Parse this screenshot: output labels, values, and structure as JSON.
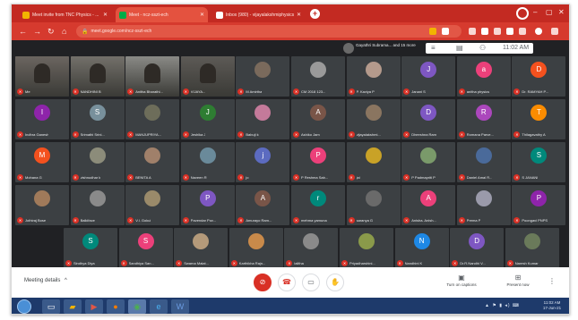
{
  "browser": {
    "tabs": [
      {
        "title": "Meet invite from TNC Physics - ...",
        "favicon_color": "#f2b400",
        "active": false
      },
      {
        "title": "Meet - ncz-sszt-ech",
        "favicon_color": "#00ac47",
        "active": true
      },
      {
        "title": "Inbox (980) - vijayalakshmiphysics...",
        "favicon_color": "#ffffff",
        "active": false
      }
    ],
    "new_tab": "+",
    "url": "meet.google.com/ncz-sszt-ech",
    "window_controls": [
      "–",
      "▢",
      "✕"
    ]
  },
  "meet_header": {
    "presenter_text": "Gayathri Subrama... and 15 more",
    "clock": "11:02 AM"
  },
  "participants": [
    {
      "name": "Me",
      "kind": "video",
      "color": "#6b6560"
    },
    {
      "name": "NANDHINI B",
      "kind": "video",
      "color": "#73706a"
    },
    {
      "name": "Anitha Bharathi...",
      "kind": "video",
      "color": "#8a8a86"
    },
    {
      "name": "VIJAYA...",
      "kind": "video",
      "color": "#5d5a56"
    },
    {
      "name": "M Amirtha",
      "kind": "photo",
      "color": "#7a6a5c",
      "initial": ""
    },
    {
      "name": "CM 2018 123...",
      "kind": "photo",
      "color": "#9a9a9a",
      "initial": ""
    },
    {
      "name": "P. Kaviya P",
      "kind": "photo",
      "color": "#b49a8c",
      "initial": ""
    },
    {
      "name": "Janani S",
      "kind": "letter",
      "color": "#7e57c2",
      "initial": "J"
    },
    {
      "name": "anitha physics",
      "kind": "letter",
      "color": "#ec407a",
      "initial": "a"
    },
    {
      "name": "Dr. RAMYAH P...",
      "kind": "letter",
      "color": "#f4511e",
      "initial": "D"
    },
    {
      "name": "Indhra Ganesh",
      "kind": "letter",
      "color": "#8e24aa",
      "initial": "I"
    },
    {
      "name": "Srimathi Srini...",
      "kind": "letter",
      "color": "#78909c",
      "initial": "S"
    },
    {
      "name": "MANJUPRIYA...",
      "kind": "photo",
      "color": "#6d6d5a",
      "initial": ""
    },
    {
      "name": "Jeshika J",
      "kind": "letter",
      "color": "#2e7d32",
      "initial": "J"
    },
    {
      "name": "Babuji k",
      "kind": "photo",
      "color": "#c47a9a",
      "initial": ""
    },
    {
      "name": "Ashiko Jam",
      "kind": "letter",
      "color": "#795548",
      "initial": "A"
    },
    {
      "name": "vijayalakshmi...",
      "kind": "photo",
      "color": "#8a7560",
      "initial": ""
    },
    {
      "name": "Dheeshna Ram",
      "kind": "letter",
      "color": "#7e57c2",
      "initial": "D"
    },
    {
      "name": "Romana Parve...",
      "kind": "letter",
      "color": "#ab47bc",
      "initial": "R"
    },
    {
      "name": "Thilagavathy A",
      "kind": "letter",
      "color": "#fb8c00",
      "initial": "T"
    },
    {
      "name": "Mohana G",
      "kind": "letter",
      "color": "#f4511e",
      "initial": "M"
    },
    {
      "name": "vishnudhar k",
      "kind": "photo",
      "color": "#8c8c7a",
      "initial": ""
    },
    {
      "name": "BENITA A",
      "kind": "photo",
      "color": "#a0806a",
      "initial": ""
    },
    {
      "name": "Naveen R",
      "kind": "photo",
      "color": "#6a8a9a",
      "initial": ""
    },
    {
      "name": "jo",
      "kind": "letter",
      "color": "#5c6bc0",
      "initial": "j"
    },
    {
      "name": "P Reshma Sab...",
      "kind": "letter",
      "color": "#ec407a",
      "initial": "P"
    },
    {
      "name": "jai",
      "kind": "photo",
      "color": "#c9a227",
      "initial": ""
    },
    {
      "name": "P Padmapriti P",
      "kind": "photo",
      "color": "#7a9a6a",
      "initial": ""
    },
    {
      "name": "Daniel Amal R...",
      "kind": "photo",
      "color": "#4a6a9a",
      "initial": ""
    },
    {
      "name": "S JANANI",
      "kind": "letter",
      "color": "#00897b",
      "initial": "S"
    },
    {
      "name": "Jothiraj Bose",
      "kind": "photo",
      "color": "#a07a5a",
      "initial": ""
    },
    {
      "name": "Balkiface",
      "kind": "photo",
      "color": "#8a8a8a",
      "initial": ""
    },
    {
      "name": "V.I. Gokul",
      "kind": "photo",
      "color": "#9a8a6a",
      "initial": ""
    },
    {
      "name": "Pavendar Pov...",
      "kind": "letter",
      "color": "#7e57c2",
      "initial": "P"
    },
    {
      "name": "Amurayo Ram...",
      "kind": "letter",
      "color": "#795548",
      "initial": "A"
    },
    {
      "name": "mehma yamuna",
      "kind": "letter",
      "color": "#00897b",
      "initial": "r"
    },
    {
      "name": "saranya G",
      "kind": "photo",
      "color": "#6a6a6a",
      "initial": ""
    },
    {
      "name": "Anisha. Anish...",
      "kind": "letter",
      "color": "#ec407a",
      "initial": "A"
    },
    {
      "name": "Prema P",
      "kind": "photo",
      "color": "#9a9aaa",
      "initial": ""
    },
    {
      "name": "Poongavi PNPS",
      "kind": "letter",
      "color": "#8e24aa",
      "initial": "P"
    },
    {
      "name": "Sindhya Diya",
      "kind": "letter",
      "color": "#00897b",
      "initial": "S"
    },
    {
      "name": "Sandhiya San...",
      "kind": "letter",
      "color": "#ec407a",
      "initial": "S"
    },
    {
      "name": "Swarna Malat...",
      "kind": "photo",
      "color": "#b49a7a",
      "initial": ""
    },
    {
      "name": "Karthikha Rajn...",
      "kind": "photo",
      "color": "#c98a4a",
      "initial": ""
    },
    {
      "name": "lalitha",
      "kind": "photo",
      "color": "#8a8a8a",
      "initial": ""
    },
    {
      "name": "Priyadharshini...",
      "kind": "photo",
      "color": "#8a9a4a",
      "initial": ""
    },
    {
      "name": "Nandhini K",
      "kind": "letter",
      "color": "#1e88e5",
      "initial": "N"
    },
    {
      "name": "Dr.R.Nandhi V...",
      "kind": "letter",
      "color": "#7e57c2",
      "initial": "D"
    },
    {
      "name": "Naresh Kumar",
      "kind": "photo",
      "color": "#6a7a5a",
      "initial": ""
    }
  ],
  "controls": {
    "meeting_details": "Meeting details",
    "meeting_details_chevron": "^",
    "captions": "Turn on captions",
    "present": "Present now",
    "more": "⋮"
  },
  "taskbar": {
    "tray_icons": "▲ ⚑ ▮ ◂) ⌨",
    "time": "11:02 AM",
    "date": "17-Jun-21"
  }
}
